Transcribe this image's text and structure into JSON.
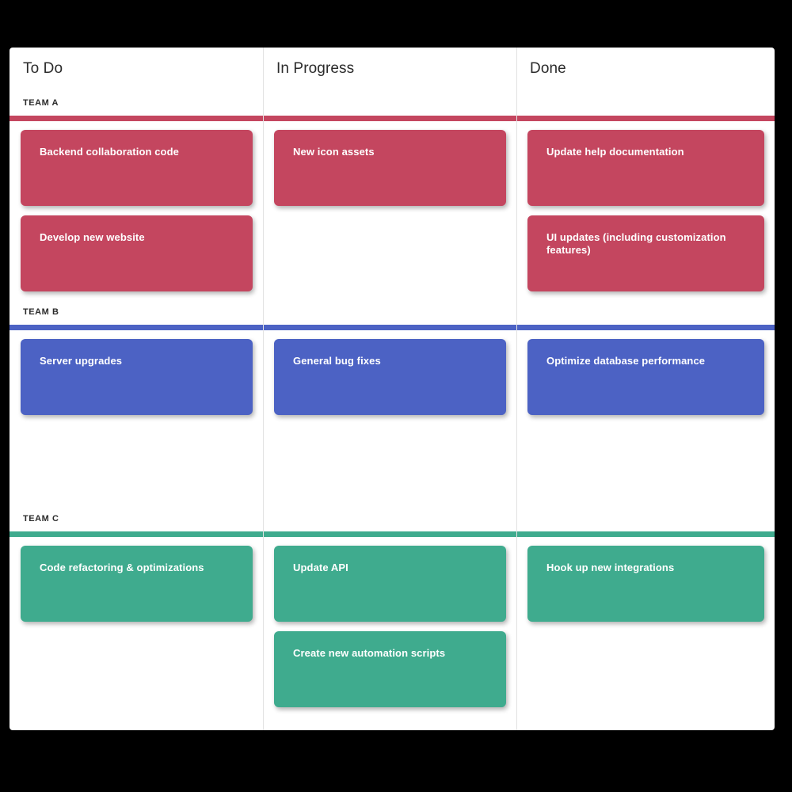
{
  "board": {
    "name": "kanban-board",
    "columns": [
      {
        "id": "todo",
        "label": "To Do"
      },
      {
        "id": "inprogress",
        "label": "In Progress"
      },
      {
        "id": "done",
        "label": "Done"
      }
    ],
    "colors": {
      "team_a": "#c4465f",
      "team_b": "#4c62c4",
      "team_c": "#3fab8e",
      "board_background": "#ffffff",
      "page_background": "#000000",
      "divider": "#e2e2e2",
      "heading_text": "#2b2b2b",
      "card_text": "#ffffff"
    },
    "swimlanes": [
      {
        "id": "team-a",
        "label": "TEAM A",
        "color": "#c4465f",
        "cards": {
          "todo": [
            {
              "title": "Backend collaboration code"
            },
            {
              "title": "Develop new website"
            }
          ],
          "inprogress": [
            {
              "title": "New icon assets"
            }
          ],
          "done": [
            {
              "title": "Update help documentation"
            },
            {
              "title": "UI updates (including customization features)"
            }
          ]
        }
      },
      {
        "id": "team-b",
        "label": "TEAM B",
        "color": "#4c62c4",
        "cards": {
          "todo": [
            {
              "title": "Server upgrades"
            }
          ],
          "inprogress": [
            {
              "title": "General bug fixes"
            }
          ],
          "done": [
            {
              "title": "Optimize database performance"
            }
          ]
        }
      },
      {
        "id": "team-c",
        "label": "TEAM C",
        "color": "#3fab8e",
        "cards": {
          "todo": [
            {
              "title": "Code refactoring & optimizations"
            }
          ],
          "inprogress": [
            {
              "title": "Update API"
            },
            {
              "title": "Create new automation scripts"
            }
          ],
          "done": [
            {
              "title": "Hook up new integrations"
            }
          ]
        }
      }
    ]
  }
}
